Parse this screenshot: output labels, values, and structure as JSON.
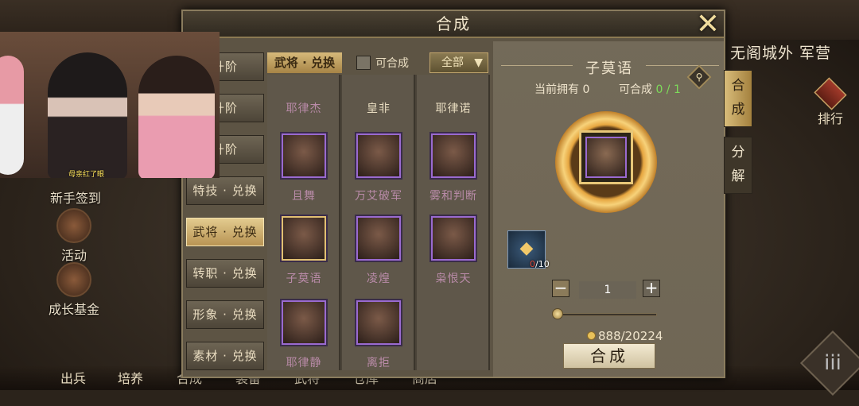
{
  "background": {
    "city_name": "无阁城外  军营",
    "left_icons": [
      "新手签到",
      "活动",
      "成长基金"
    ],
    "bottom_nav": [
      "出兵",
      "培养",
      "合成",
      "装备",
      "武将",
      "仓库",
      "商店"
    ],
    "rank_label": "排行",
    "corner_button": "iii"
  },
  "panel": {
    "title": "合成",
    "close_icon": "close-icon",
    "side_menu": [
      {
        "label": "升阶",
        "active": false
      },
      {
        "label": "升阶",
        "active": false
      },
      {
        "label": "升阶",
        "active": false
      },
      {
        "label": "特技 · 兑换",
        "active": false
      },
      {
        "label": "武将 · 兑换",
        "active": true
      },
      {
        "label": "转职 · 兑换",
        "active": false
      },
      {
        "label": "形象 · 兑换",
        "active": false
      },
      {
        "label": "素材 · 兑换",
        "active": false
      }
    ],
    "filter": {
      "active_tab": "武将 · 兑换",
      "checkbox_label": "可合成",
      "dropdown_value": "全部"
    },
    "heroes": [
      {
        "name": "耶律杰"
      },
      {
        "name": "皇非"
      },
      {
        "name": "耶律诺"
      },
      {
        "name": "且舞"
      },
      {
        "name": "万艾破军"
      },
      {
        "name": "雾和判断"
      },
      {
        "name": "子莫语"
      },
      {
        "name": "凌煌"
      },
      {
        "name": "枭恨天"
      },
      {
        "name": "耶律静"
      },
      {
        "name": "离拒"
      }
    ],
    "detail": {
      "name": "子莫语",
      "owned_label": "当前拥有",
      "owned_value": "0",
      "can_make_label": "可合成",
      "can_make_value": "0 / 1",
      "fragment_have": "0",
      "fragment_need": "/10",
      "quantity": "1",
      "cost": "888/20224",
      "make_button": "合成"
    },
    "vertical_tabs": [
      "合\n成",
      "分\n解"
    ]
  },
  "overlay": {
    "caption": "母亲红了眼"
  },
  "colors": {
    "accent_gold": "#d6b97a",
    "green": "#7ddc5a",
    "red": "#e24a3a"
  }
}
